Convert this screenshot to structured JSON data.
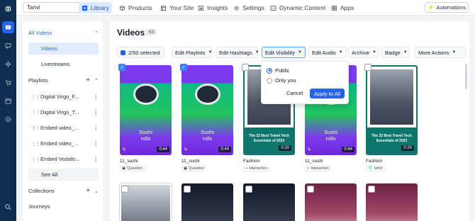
{
  "workspace": {
    "name": "Tanvi"
  },
  "nav": {
    "tabs": [
      {
        "label": "Library",
        "icon": "library-icon"
      },
      {
        "label": "Products",
        "icon": "box-icon"
      },
      {
        "label": "Your Site",
        "icon": "table-icon"
      },
      {
        "label": "Insights",
        "icon": "bar-chart-icon"
      },
      {
        "label": "Settings",
        "icon": "gear-icon"
      },
      {
        "label": "Dynamic Content",
        "icon": "code-icon"
      },
      {
        "label": "Apps",
        "icon": "grid-icon"
      }
    ],
    "automations": "Automations"
  },
  "sidebar": {
    "all_videos": "All Videos",
    "videos": "Videos",
    "livestreams": "Livestreams",
    "playlists": "Playlists",
    "playlist_items": [
      "Digital Virgo_F...",
      "Digital Virgo_T...",
      "Embed video_...",
      "Embed video_...",
      "Embed Vodafo..."
    ],
    "see_all": "See All",
    "collections": "Collections",
    "journeys": "Journeys"
  },
  "main": {
    "title": "Videos",
    "count": "63",
    "toolbar": {
      "selected": "2/50 selected",
      "edit_playlists": "Edit Playlists",
      "edit_hashtags": "Edit Hashtags",
      "edit_visibility": "Edit Visibility",
      "edit_audio": "Edit Audio",
      "archive": "Archive",
      "badge": "Badge",
      "more_actions": "More Actions"
    },
    "cards": [
      {
        "name": "11_sushi",
        "tag": "Question",
        "duration": "0:44",
        "thumb_text": "Sushi\nrolls",
        "checked": true
      },
      {
        "name": "11_sushi",
        "tag": "Question",
        "duration": "0:44",
        "thumb_text": "Sushi\nrolls",
        "checked": true
      },
      {
        "name": "Fashion",
        "tag": "Interaction",
        "duration": "0:20",
        "thumb_text": "The 22 Best Travel Tech Essentials of 2023",
        "checked": false
      },
      {
        "name": "11_sushi",
        "tag": "Interaction",
        "duration": "0:44",
        "thumb_text": "Sushi\nrolls",
        "checked": false
      },
      {
        "name": "Fashion",
        "tag": "tshirt",
        "duration": "0:20",
        "thumb_text": "The 22 Best Travel Tech Essentials of 2023",
        "checked": false
      }
    ]
  },
  "visibility_popover": {
    "options": [
      "Public",
      "Only you"
    ],
    "selected": "Public",
    "cancel": "Cancel",
    "apply": "Apply to All"
  },
  "colors": {
    "accent": "#2563eb",
    "rail": "#0f2d4e"
  }
}
